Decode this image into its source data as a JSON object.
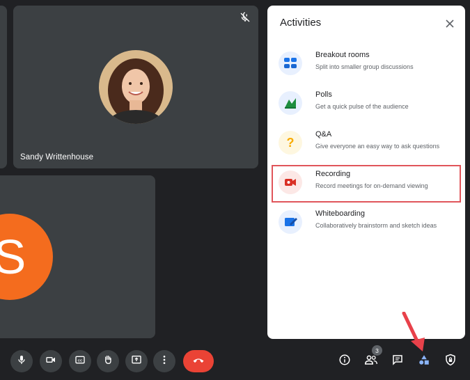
{
  "participants": {
    "sandy_name": "Sandy Writtenhouse",
    "second_initial": "S"
  },
  "colors": {
    "background": "#202124",
    "tile": "#3c4043",
    "avatar_orange": "#f46c1e",
    "end_call_red": "#ea4335",
    "highlight_red": "#e0555a",
    "annotation_arrow": "#e8414a"
  },
  "panel": {
    "title": "Activities",
    "close_icon": "close-icon",
    "items": [
      {
        "icon": "breakout-rooms-icon",
        "title": "Breakout rooms",
        "description": "Split into smaller group discussions"
      },
      {
        "icon": "polls-icon",
        "title": "Polls",
        "description": "Get a quick pulse of the audience"
      },
      {
        "icon": "qa-icon",
        "title": "Q&A",
        "description": "Give everyone an easy way to ask questions"
      },
      {
        "icon": "recording-icon",
        "title": "Recording",
        "description": "Record meetings for on-demand viewing"
      },
      {
        "icon": "whiteboarding-icon",
        "title": "Whiteboarding",
        "description": "Collaboratively brainstorm and sketch ideas"
      }
    ]
  },
  "toolbar": {
    "controls": [
      "mic-icon",
      "camera-icon",
      "captions-icon",
      "raise-hand-icon",
      "present-icon",
      "more-options-icon",
      "end-call-icon"
    ],
    "right_controls": [
      "info-icon",
      "people-icon",
      "chat-icon",
      "activities-icon",
      "host-controls-icon"
    ],
    "people_count": "3"
  }
}
